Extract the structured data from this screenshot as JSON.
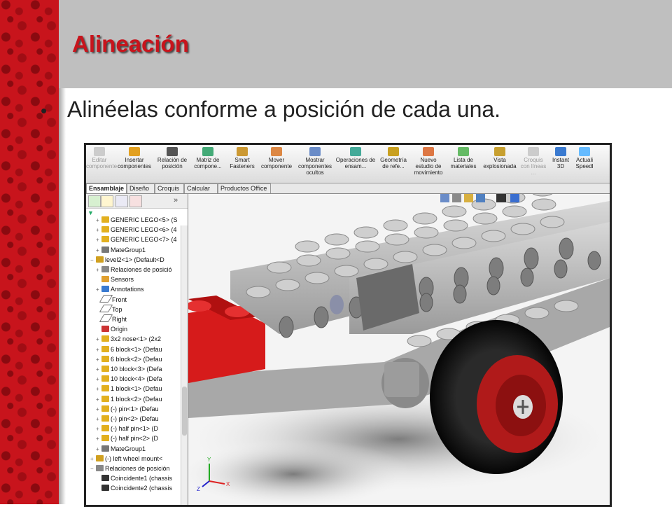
{
  "slide": {
    "title": "Alineación",
    "bullet": "Alinéelas conforme a posición de cada una."
  },
  "colors": {
    "accent_red": "#c8141c",
    "title_band": "#bfbfbf",
    "lego_gray": "#bdbdbd",
    "lego_red": "#d61b1b"
  },
  "ribbon": {
    "buttons": [
      {
        "label": "Editar componente",
        "icon": "edit-component-icon",
        "disabled": true
      },
      {
        "label": "Insertar componentes",
        "icon": "insert-components-icon",
        "disabled": false
      },
      {
        "label": "Relación de posición",
        "icon": "mate-icon",
        "disabled": false
      },
      {
        "label": "Matriz de compone...",
        "icon": "pattern-icon",
        "disabled": false
      },
      {
        "label": "Smart Fasteners",
        "icon": "fastener-icon",
        "disabled": false
      },
      {
        "label": "Mover componente",
        "icon": "move-component-icon",
        "disabled": false
      },
      {
        "label": "Mostrar componentes ocultos",
        "icon": "show-hidden-icon",
        "disabled": false
      },
      {
        "label": "Operaciones de ensam...",
        "icon": "assembly-features-icon",
        "disabled": false
      },
      {
        "label": "Geometría de refe...",
        "icon": "reference-geometry-icon",
        "disabled": false
      },
      {
        "label": "Nuevo estudio de movimiento",
        "icon": "motion-study-icon",
        "disabled": false
      },
      {
        "label": "Lista de materiales",
        "icon": "bom-icon",
        "disabled": false
      },
      {
        "label": "Vista explosionada",
        "icon": "exploded-view-icon",
        "disabled": false
      },
      {
        "label": "Croquis con líneas ...",
        "icon": "explode-sketch-icon",
        "disabled": true
      },
      {
        "label": "Instant 3D",
        "icon": "instant3d-icon",
        "disabled": false
      },
      {
        "label": "Actuali Speedl",
        "icon": "speedpak-icon",
        "disabled": false
      }
    ]
  },
  "tabs": [
    {
      "label": "Ensamblaje",
      "active": true
    },
    {
      "label": "Diseño",
      "active": false
    },
    {
      "label": "Croquis",
      "active": false
    },
    {
      "label": "Calcular",
      "active": false
    },
    {
      "label": "Productos Office",
      "active": false
    }
  ],
  "tree": {
    "more": "»",
    "items": [
      {
        "label": "GENERIC LEGO<5> (S",
        "icon": "part-icon",
        "exp": "+",
        "indent": 1
      },
      {
        "label": "GENERIC LEGO<6> (4",
        "icon": "part-icon",
        "exp": "+",
        "indent": 1
      },
      {
        "label": "GENERIC LEGO<7> (4",
        "icon": "part-icon",
        "exp": "+",
        "indent": 1
      },
      {
        "label": "MateGroup1",
        "icon": "mate-group-icon",
        "exp": "+",
        "indent": 1
      },
      {
        "label": "level2<1> (Default<D",
        "icon": "subassembly-icon",
        "exp": "−",
        "indent": 0
      },
      {
        "label": "Relaciones de posició",
        "icon": "mates-folder-icon",
        "exp": "+",
        "indent": 1
      },
      {
        "label": "Sensors",
        "icon": "sensors-icon",
        "exp": "",
        "indent": 1
      },
      {
        "label": "Annotations",
        "icon": "annotations-icon",
        "exp": "+",
        "indent": 1
      },
      {
        "label": "Front",
        "icon": "plane-icon",
        "exp": "",
        "indent": 1
      },
      {
        "label": "Top",
        "icon": "plane-icon",
        "exp": "",
        "indent": 1
      },
      {
        "label": "Right",
        "icon": "plane-icon",
        "exp": "",
        "indent": 1
      },
      {
        "label": "Origin",
        "icon": "origin-icon",
        "exp": "",
        "indent": 1
      },
      {
        "label": "3x2 nose<1> (2x2",
        "icon": "part-icon",
        "exp": "+",
        "indent": 1
      },
      {
        "label": "6 block<1> (Defau",
        "icon": "part-icon",
        "exp": "+",
        "indent": 1
      },
      {
        "label": "6 block<2> (Defau",
        "icon": "part-icon",
        "exp": "+",
        "indent": 1
      },
      {
        "label": "10 block<3> (Defa",
        "icon": "part-icon",
        "exp": "+",
        "indent": 1
      },
      {
        "label": "10 block<4> (Defa",
        "icon": "part-icon",
        "exp": "+",
        "indent": 1
      },
      {
        "label": "1 block<1> (Defau",
        "icon": "part-icon",
        "exp": "+",
        "indent": 1
      },
      {
        "label": "1 block<2> (Defau",
        "icon": "part-icon",
        "exp": "+",
        "indent": 1
      },
      {
        "label": "(-) pin<1> (Defau",
        "icon": "part-icon",
        "exp": "+",
        "indent": 1
      },
      {
        "label": "(-) pin<2> (Defau",
        "icon": "part-icon",
        "exp": "+",
        "indent": 1
      },
      {
        "label": "(-) half pin<1> (D",
        "icon": "part-icon",
        "exp": "+",
        "indent": 1
      },
      {
        "label": "(-) half pin<2> (D",
        "icon": "part-icon",
        "exp": "+",
        "indent": 1
      },
      {
        "label": "MateGroup1",
        "icon": "mate-group-icon",
        "exp": "+",
        "indent": 1
      },
      {
        "label": "(-) left wheel mount<",
        "icon": "subassembly-icon",
        "exp": "+",
        "indent": 0
      },
      {
        "label": "Relaciones de posición",
        "icon": "mates-folder-icon",
        "exp": "−",
        "indent": 0
      },
      {
        "label": "Coincidente1 (chassis",
        "icon": "coincident-icon",
        "exp": "",
        "indent": 1
      },
      {
        "label": "Coincidente2 (chassis",
        "icon": "coincident-icon",
        "exp": "",
        "indent": 1
      }
    ]
  },
  "viewport": {
    "triad": {
      "x": "X",
      "y": "Y",
      "z": "Z"
    }
  }
}
